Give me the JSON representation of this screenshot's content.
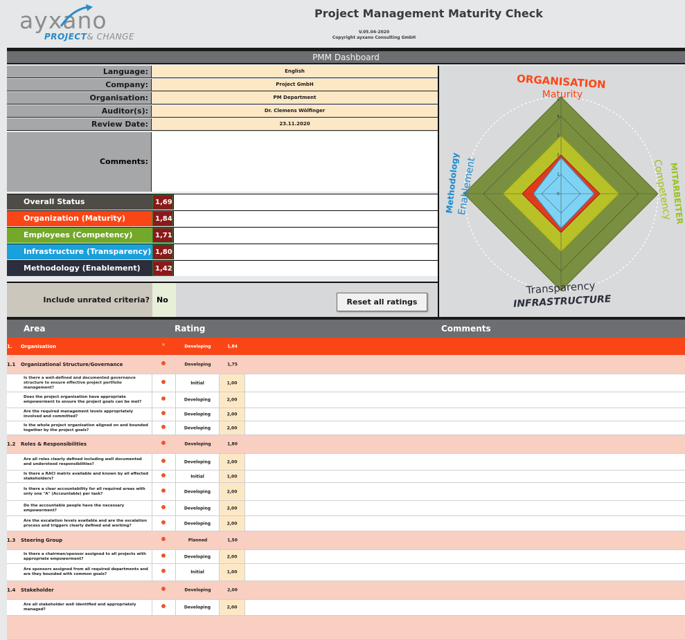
{
  "header": {
    "logo_main": "ayxano",
    "logo_sub_a": "PROJECT",
    "logo_sub_b": "& CHANGE",
    "title": "Project Management Maturity Check",
    "version": "V.05.04-2020",
    "copyright": "Copyright ayxano Consulting GmbH"
  },
  "dashboard_title": "PMM Dashboard",
  "info": {
    "language_label": "Language:",
    "language": "English",
    "company_label": "Company:",
    "company": "Project GmbH",
    "organisation_label": "Organisation:",
    "organisation": "PM Department",
    "auditor_label": "Auditor(s):",
    "auditor": "Dr. Clemens Wölfinger",
    "review_date_label": "Review Date:",
    "review_date": "23.11.2020",
    "comments_label": "Comments:"
  },
  "status": [
    {
      "label": "Overall Status",
      "value": "1,69",
      "color": "#4f4c48"
    },
    {
      "label": "Organization (Maturity)",
      "value": "1,84",
      "color": "#fa4616"
    },
    {
      "label": "Employees (Competency)",
      "value": "1,71",
      "color": "#74a82a"
    },
    {
      "label": "Infrastructure (Transparency)",
      "value": "1,80",
      "color": "#1aa0dc"
    },
    {
      "label": "Methodology (Enablement)",
      "value": "1,42",
      "color": "#2b2f3d"
    }
  ],
  "unrated": {
    "label": "Include unrated criteria?",
    "value": "No"
  },
  "reset_button": "Reset all ratings",
  "radar": {
    "top_title": "ORGANISATION",
    "top_sub": "Maturity",
    "right_title": "MITARBEITER",
    "right_sub": "Competency",
    "bottom_title": "INFRASTRUCTURE",
    "bottom_sub": "Transparency",
    "left_title": "Methodology",
    "left_sub": "Enablement",
    "ticks": [
      "0",
      "1",
      "2",
      "3",
      "4",
      "5"
    ]
  },
  "table": {
    "head_area": "Area",
    "head_rating": "Rating",
    "head_comments": "Comments",
    "rows": [
      {
        "type": "top",
        "no": "1.",
        "text": "Organisation",
        "rating": "Developing",
        "value": "1,84"
      },
      {
        "type": "sec",
        "no": "1.1",
        "text": "Organizational Structure/Governance",
        "rating": "Developing",
        "value": "1,75"
      },
      {
        "type": "q",
        "text": "Is there a well-defined and documented governance structure to ensure effective project portfolio management?",
        "rating": "Initial",
        "value": "1,00"
      },
      {
        "type": "q",
        "text": "Does the project organisation have appropriate empowerment to ensure the project goals can be met?",
        "rating": "Developing",
        "value": "2,00"
      },
      {
        "type": "q",
        "text": "Are the required management levels appropriately involved and committed?",
        "rating": "Developing",
        "value": "2,00"
      },
      {
        "type": "q",
        "text": "Is the whole project organisation aligned on and bounded together by the project goals?",
        "rating": "Developing",
        "value": "2,00"
      },
      {
        "type": "sec",
        "no": "1.2",
        "text": "Roles & Responsibilities",
        "rating": "Developing",
        "value": "1,80"
      },
      {
        "type": "q",
        "text": "Are all roles clearly defined including well documented and understood responsibilities?",
        "rating": "Developing",
        "value": "2,00"
      },
      {
        "type": "q",
        "text": "Is there a RACI matrix available and known by all affected stakeholders?",
        "rating": "Initial",
        "value": "1,00"
      },
      {
        "type": "q",
        "text": "Is there a clear accountability for all required areas with only one \"A\" (Accountable) per task?",
        "rating": "Developing",
        "value": "2,00"
      },
      {
        "type": "q",
        "text": "Do the accountable people have the necessary empowerment?",
        "rating": "Developing",
        "value": "2,00"
      },
      {
        "type": "q",
        "text": "Are the escalation levels available and are the escalation process and triggers clearly defined and working?",
        "rating": "Developing",
        "value": "2,00"
      },
      {
        "type": "sec",
        "no": "1.3",
        "text": "Steering Group",
        "rating": "Planned",
        "value": "1,50"
      },
      {
        "type": "q",
        "text": "Is there a chairman/sponsor assigned to all projects with appropriate empowerment?",
        "rating": "Developing",
        "value": "2,00"
      },
      {
        "type": "q",
        "text": "Are sponsors assigned from all required departments and are they bounded with common goals?",
        "rating": "Initial",
        "value": "1,00"
      },
      {
        "type": "sec",
        "no": "1.4",
        "text": "Stakeholder",
        "rating": "Developing",
        "value": "2,00"
      },
      {
        "type": "q",
        "text": "Are all stakeholder well identified and appropriately managed?",
        "rating": "Developing",
        "value": "2,00"
      }
    ]
  }
}
